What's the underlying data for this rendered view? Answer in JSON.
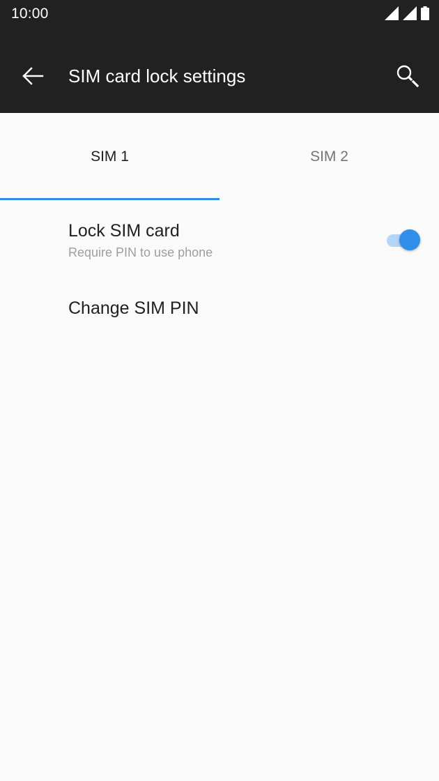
{
  "status_bar": {
    "time": "10:00",
    "icons": [
      "signal-icon",
      "signal-icon",
      "battery-icon"
    ]
  },
  "app_bar": {
    "title": "SIM card lock settings",
    "back_icon": "arrow-left-icon",
    "search_icon": "search-icon"
  },
  "tabs": [
    {
      "label": "SIM 1",
      "selected": true
    },
    {
      "label": "SIM 2",
      "selected": false
    }
  ],
  "settings": {
    "lock_sim": {
      "title": "Lock SIM card",
      "summary": "Require PIN to use phone",
      "enabled": true
    },
    "change_pin": {
      "title": "Change SIM PIN"
    }
  },
  "colors": {
    "app_bar": "#212121",
    "accent": "#2f8ee8",
    "background": "#fafafa"
  }
}
